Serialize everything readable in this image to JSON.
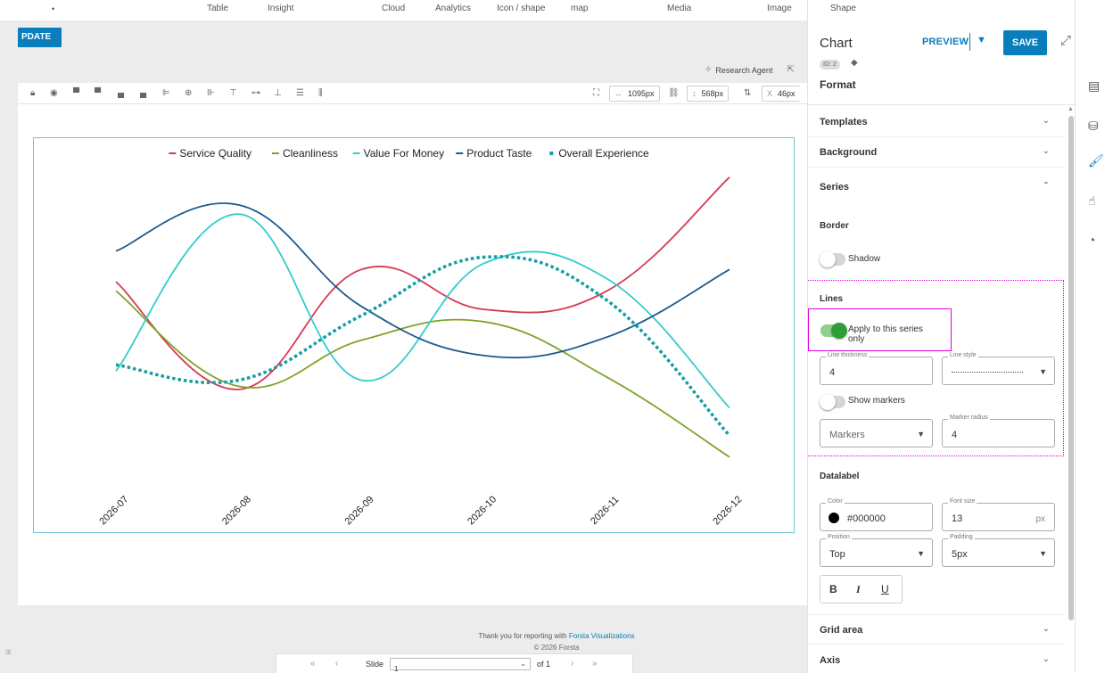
{
  "topbar": {
    "dot": "•",
    "categories": [
      "Table",
      "Insight",
      "Cloud",
      "Analytics",
      "Icon / shape",
      "map",
      "Media",
      "Image",
      "Shape"
    ]
  },
  "update_label": "PDATE",
  "research_agent": "Research Agent",
  "toolbar": {
    "width_value": "1095px",
    "height_value": "568px",
    "x_label": "X",
    "x_value": "46px"
  },
  "chart_data": {
    "type": "line",
    "categories": [
      "2026-07",
      "2026-08",
      "2026-09",
      "2026-10",
      "2026-11",
      "2026-12"
    ],
    "series": [
      {
        "name": "Service Quality",
        "color": "#d43a55",
        "style": "solid",
        "values": [
          62,
          27,
          66,
          53,
          59,
          96
        ]
      },
      {
        "name": "Cleanliness",
        "color": "#7ea428",
        "style": "solid",
        "values": [
          59,
          28,
          43,
          49,
          31,
          5
        ]
      },
      {
        "name": "Value For Money",
        "color": "#35cbcb",
        "style": "solid",
        "values": [
          33,
          84,
          30,
          68,
          63,
          21
        ]
      },
      {
        "name": "Product Taste",
        "color": "#1e5a8c",
        "style": "solid",
        "values": [
          72,
          87,
          54,
          38,
          44,
          66
        ]
      },
      {
        "name": "Overall Experience",
        "color": "#149ea2",
        "style": "dotted",
        "values": [
          35,
          30,
          51,
          70,
          56,
          12
        ]
      }
    ],
    "legend_position": "top",
    "grid": false,
    "ylim": [
      0,
      100
    ]
  },
  "footer": {
    "thanks_prefix": "Thank you for reporting with ",
    "thanks_link": "Forsta Visualizations",
    "copyright": "© 2026 Forsta"
  },
  "pager": {
    "first": "«",
    "prev": "‹",
    "slide_label": "Slide",
    "slide_value": "1",
    "of_label": "of 1",
    "next": "›",
    "last": "»"
  },
  "panel": {
    "title": "Chart",
    "preview_label": "PREVIEW",
    "save_label": "SAVE",
    "id_badge": "ID: 2",
    "format_label": "Format",
    "sections": {
      "templates": "Templates",
      "background": "Background",
      "series": "Series",
      "grid_area": "Grid area",
      "axis": "Axis"
    },
    "border_label": "Border",
    "shadow_label": "Shadow",
    "lines_label": "Lines",
    "apply_label_1": "Apply to this series",
    "apply_label_2": "only",
    "line_thickness_label": "Line thickness",
    "line_thickness_value": "4",
    "line_style_label": "Line style",
    "show_markers_label": "Show markers",
    "markers_placeholder": "Markers",
    "marker_radius_label": "Marker radius",
    "marker_radius_value": "4",
    "datalabel_label": "Datalabel",
    "color_label": "Color",
    "color_value": "#000000",
    "font_size_label": "Font size",
    "font_size_value": "13",
    "font_size_unit": "px",
    "position_label": "Position",
    "position_value": "Top",
    "padding_label": "Padding",
    "padding_value": "5px",
    "bold": "B",
    "italic": "I",
    "underline": "U"
  },
  "colors": {
    "accent": "#0a7dbd",
    "highlight": "#e000e0",
    "toggle_on": "#2e9e3a"
  }
}
